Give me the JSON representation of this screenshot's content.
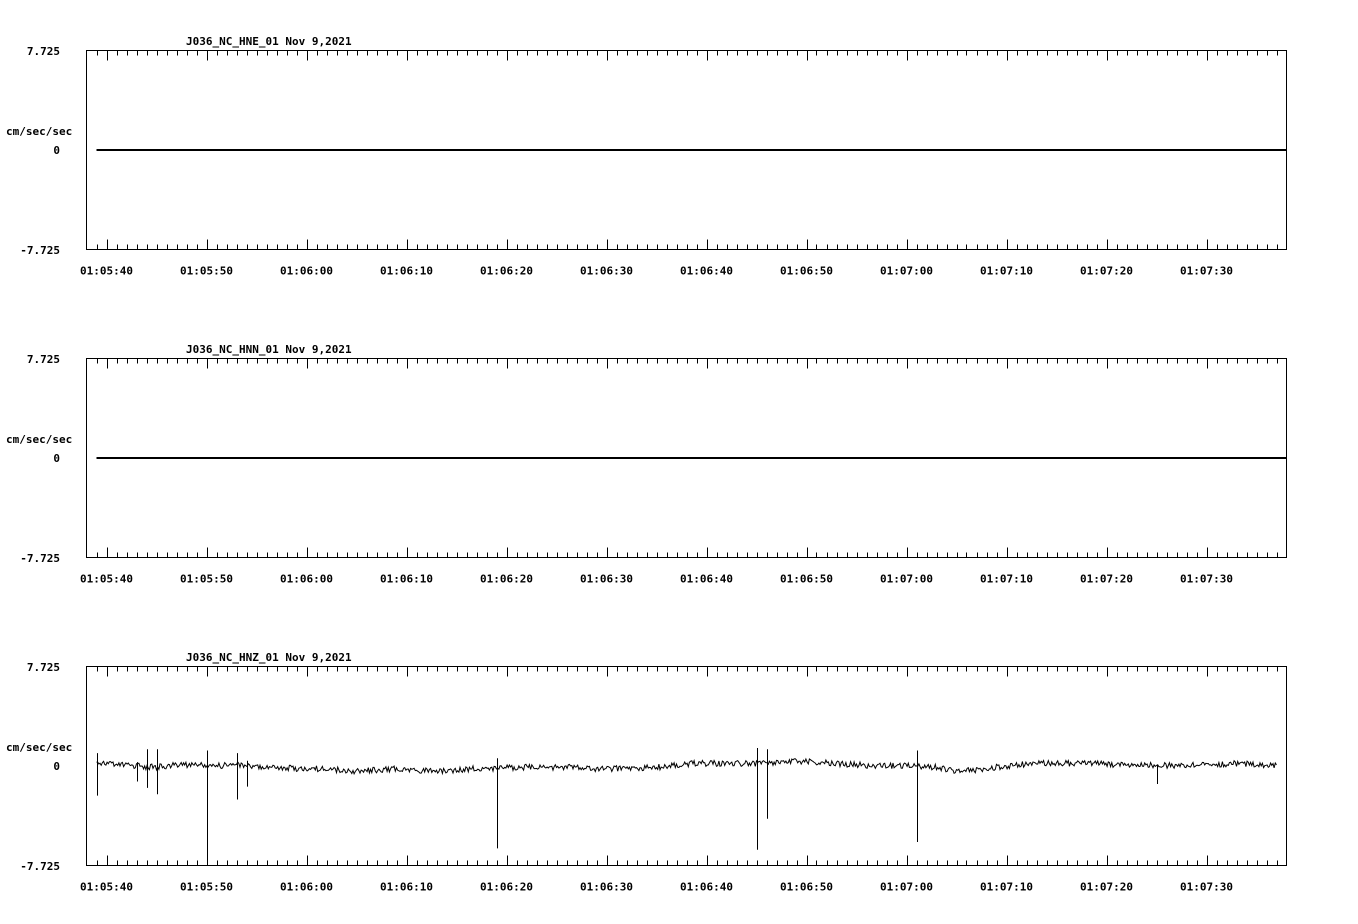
{
  "chart_data": [
    {
      "type": "line",
      "title": "J036_NC_HNE_01   Nov 9,2021",
      "ylabel": "cm/sec/sec",
      "ylim": [
        -7.725,
        7.725
      ],
      "y_tick_labels": [
        "7.725",
        "0",
        "-7.725"
      ],
      "x_tick_labels": [
        "01:05:40",
        "01:05:50",
        "01:06:00",
        "01:06:10",
        "01:06:20",
        "01:06:30",
        "01:06:40",
        "01:06:50",
        "01:07:00",
        "01:07:10",
        "01:07:20",
        "01:07:30"
      ],
      "xlim": [
        "01:05:38",
        "01:07:38"
      ],
      "series": [
        {
          "x": [
            "01:05:39",
            "01:07:38"
          ],
          "values": [
            0,
            0
          ]
        }
      ]
    },
    {
      "type": "line",
      "title": "J036_NC_HNN_01   Nov 9,2021",
      "ylabel": "cm/sec/sec",
      "ylim": [
        -7.725,
        7.725
      ],
      "y_tick_labels": [
        "7.725",
        "0",
        "-7.725"
      ],
      "x_tick_labels": [
        "01:05:40",
        "01:05:50",
        "01:06:00",
        "01:06:10",
        "01:06:20",
        "01:06:30",
        "01:06:40",
        "01:06:50",
        "01:07:00",
        "01:07:10",
        "01:07:20",
        "01:07:30"
      ],
      "xlim": [
        "01:05:38",
        "01:07:38"
      ],
      "series": [
        {
          "x": [
            "01:05:39",
            "01:07:38"
          ],
          "values": [
            0,
            0
          ]
        }
      ]
    },
    {
      "type": "line",
      "title": "J036_NC_HNZ_01   Nov 9,2021",
      "ylabel": "cm/sec/sec",
      "ylim": [
        -7.725,
        7.725
      ],
      "y_tick_labels": [
        "7.725",
        "0",
        "-7.725"
      ],
      "x_tick_labels": [
        "01:05:40",
        "01:05:50",
        "01:06:00",
        "01:06:10",
        "01:06:20",
        "01:06:30",
        "01:06:40",
        "01:06:50",
        "01:07:00",
        "01:07:10",
        "01:07:20",
        "01:07:30"
      ],
      "xlim": [
        "01:05:38",
        "01:07:38"
      ],
      "series": [
        {
          "x": [
            "01:05:39",
            "01:05:41",
            "01:05:43",
            "01:05:45",
            "01:05:47",
            "01:05:49",
            "01:05:51",
            "01:05:53",
            "01:05:55",
            "01:05:57",
            "01:05:59",
            "01:06:01",
            "01:06:03",
            "01:06:05",
            "01:06:07",
            "01:06:09",
            "01:06:11",
            "01:06:13",
            "01:06:15",
            "01:06:17",
            "01:06:19",
            "01:06:21",
            "01:06:23",
            "01:06:25",
            "01:06:27",
            "01:06:29",
            "01:06:31",
            "01:06:33",
            "01:06:35",
            "01:06:37",
            "01:06:39",
            "01:06:41",
            "01:06:43",
            "01:06:45",
            "01:06:47",
            "01:06:49",
            "01:06:51",
            "01:06:53",
            "01:06:55",
            "01:06:57",
            "01:06:59",
            "01:07:01",
            "01:07:03",
            "01:07:05",
            "01:07:07",
            "01:07:09",
            "01:07:11",
            "01:07:13",
            "01:07:15",
            "01:07:17",
            "01:07:19",
            "01:07:21",
            "01:07:23",
            "01:07:25",
            "01:07:27",
            "01:07:29",
            "01:07:31",
            "01:07:33",
            "01:07:35",
            "01:07:37"
          ],
          "values": [
            0.3,
            0.1,
            0,
            -0.1,
            0.1,
            0.1,
            0,
            0.1,
            0,
            -0.1,
            -0.2,
            -0.2,
            -0.3,
            -0.4,
            -0.3,
            -0.2,
            -0.3,
            -0.4,
            -0.3,
            -0.2,
            -0.2,
            -0.1,
            -0.1,
            -0.1,
            -0.1,
            -0.2,
            -0.2,
            -0.2,
            -0.1,
            0.1,
            0.2,
            0.2,
            0.2,
            0.2,
            0.3,
            0.4,
            0.3,
            0.2,
            0.1,
            0,
            0,
            0,
            -0.1,
            -0.4,
            -0.3,
            -0.1,
            0.1,
            0.2,
            0.2,
            0.2,
            0.2,
            0.1,
            0.1,
            0.1,
            0,
            0.1,
            0.1,
            0.2,
            0.1,
            0
          ]
        }
      ],
      "spikes": [
        {
          "x": "01:05:39",
          "min": -2.3,
          "max": 1.0
        },
        {
          "x": "01:05:43",
          "min": -1.2,
          "max": 0.3
        },
        {
          "x": "01:05:44",
          "min": -1.7,
          "max": 1.3
        },
        {
          "x": "01:05:45",
          "min": -2.2,
          "max": 1.3
        },
        {
          "x": "01:05:50",
          "min": -7.3,
          "max": 1.2
        },
        {
          "x": "01:05:53",
          "min": -2.6,
          "max": 1.0
        },
        {
          "x": "01:05:54",
          "min": -1.6,
          "max": 0.4
        },
        {
          "x": "01:06:19",
          "min": -6.4,
          "max": 0.6
        },
        {
          "x": "01:06:45",
          "min": -6.5,
          "max": 1.4
        },
        {
          "x": "01:06:46",
          "min": -4.1,
          "max": 1.3
        },
        {
          "x": "01:07:01",
          "min": -5.9,
          "max": 1.2
        },
        {
          "x": "01:07:25",
          "min": -1.4,
          "max": 0.1
        }
      ]
    }
  ]
}
